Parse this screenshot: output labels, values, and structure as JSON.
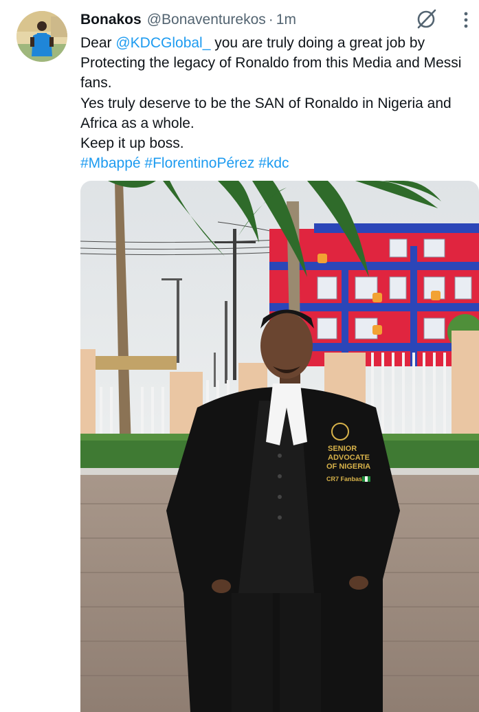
{
  "tweet": {
    "author_name": "Bonakos",
    "author_handle": "@Bonaventurekos",
    "time_separator": "·",
    "timestamp": "1m",
    "text": {
      "line1_prefix": "Dear ",
      "mention": "@KDCGlobal_",
      "line1_rest": " you are truly doing a great job by Protecting the legacy of Ronaldo from this Media and Messi fans.",
      "line2": "Yes truly deserve to be the SAN of Ronaldo in Nigeria and Africa as a whole.",
      "line3": "Keep it up boss.",
      "hashtags": [
        "#Mbappé",
        "#FlorentinoPérez",
        "#kdc"
      ]
    },
    "photo": {
      "badge_line1": "SENIOR",
      "badge_line2": "ADVOCATE",
      "badge_line3": "OF NIGERIA",
      "badge_line4": "CR7 Fanbase"
    }
  },
  "icons": {
    "grok": "grok-icon",
    "more": "more-options-icon"
  },
  "colors": {
    "link": "#1d9bf0",
    "secondary_text": "#536471",
    "primary_text": "#0f1419"
  }
}
